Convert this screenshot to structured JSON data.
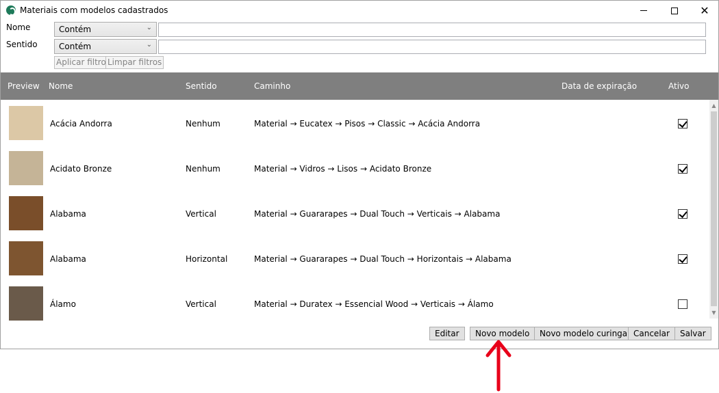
{
  "window": {
    "title": "Materiais com modelos cadastrados"
  },
  "filters": {
    "nome_label": "Nome",
    "sentido_label": "Sentido",
    "nome_op": "Contém",
    "sentido_op": "Contém",
    "nome_value": "",
    "sentido_value": "",
    "apply_label": "Aplicar filtros",
    "clear_label": "Limpar filtros"
  },
  "table": {
    "headers": {
      "preview": "Preview",
      "nome": "Nome",
      "sentido": "Sentido",
      "caminho": "Caminho",
      "data": "Data de expiração",
      "ativo": "Ativo"
    },
    "rows": [
      {
        "nome": "Acácia Andorra",
        "sentido": "Nenhum",
        "caminho": "Material → Eucatex → Pisos → Classic → Acácia Andorra",
        "data": "",
        "ativo": true,
        "swatch": "#dcc8a6"
      },
      {
        "nome": "Acidato Bronze",
        "sentido": "Nenhum",
        "caminho": "Material → Vidros → Lisos → Acidato Bronze",
        "data": "",
        "ativo": true,
        "swatch": "#c5b497"
      },
      {
        "nome": "Alabama",
        "sentido": "Vertical",
        "caminho": "Material → Guararapes → Dual Touch → Verticais → Alabama",
        "data": "",
        "ativo": true,
        "swatch": "#7a4e2a"
      },
      {
        "nome": "Alabama",
        "sentido": "Horizontal",
        "caminho": "Material → Guararapes → Dual Touch → Horizontais → Alabama",
        "data": "",
        "ativo": true,
        "swatch": "#7e5530"
      },
      {
        "nome": "Álamo",
        "sentido": "Vertical",
        "caminho": "Material → Duratex → Essencial Wood → Verticais → Álamo",
        "data": "",
        "ativo": false,
        "swatch": "#6a5a4a"
      }
    ]
  },
  "actions": {
    "edit": "Editar",
    "new_model": "Novo modelo",
    "new_wildcard": "Novo modelo curinga",
    "cancel": "Cancelar",
    "save": "Salvar"
  },
  "colors": {
    "header_bg": "#7f7f7f",
    "annotation_arrow": "#e8001a",
    "app_icon": "#1e7a5a"
  },
  "icons": {
    "app": "app-logo-icon",
    "minimize": "minimize-icon",
    "maximize": "maximize-icon",
    "close": "close-icon",
    "dropdown": "chevron-down-icon"
  }
}
